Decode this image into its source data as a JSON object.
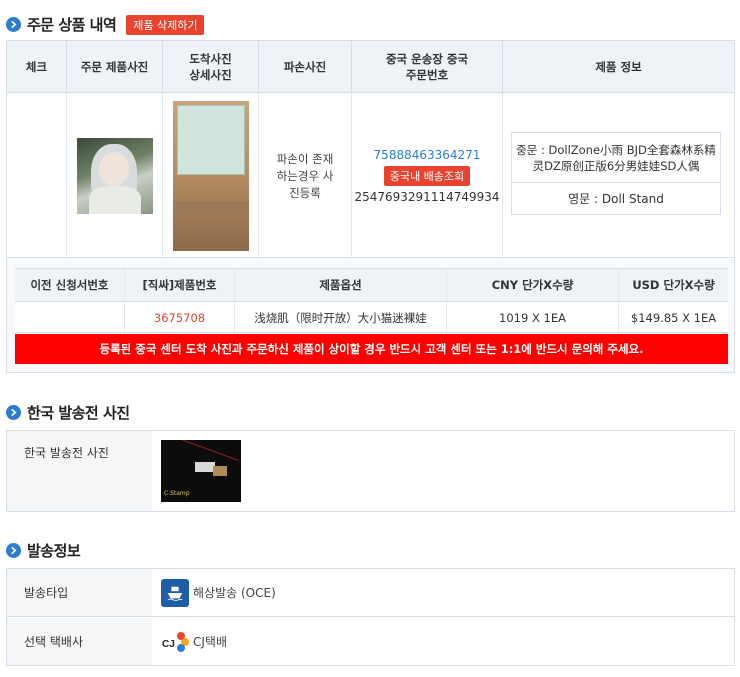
{
  "order": {
    "title": "주문 상품 내역",
    "delete_btn": "제품 삭제하기",
    "headers": {
      "check": "체크",
      "photo": "주문 제품사진",
      "arrival": "도착사진 상세사진",
      "damage": "파손사진",
      "tracking": "중국 운송장 중국 주문번호",
      "info": "제품 정보"
    },
    "damage_text": "파손이 존재하는경우 사진등록",
    "tracking_no": "75888463364271",
    "tracking_btn": "중국내 배송조회",
    "cn_order_no": "2547693291114749934",
    "info_cn": "중문 : DollZone小雨 BJD全套森林系精灵DZ原创正版6分男娃娃SD人偶",
    "info_en": "영문 : Doll Stand",
    "sub_headers": {
      "prev": "이전 신청서번호",
      "prodno": "[직싸]제품번호",
      "option": "제품옵션",
      "cny": "CNY 단가X수량",
      "usd": "USD 단가X수량"
    },
    "sub_row": {
      "prev": "",
      "prodno": "3675708",
      "option": "浅烧肌（限时开放）大小猫迷裸娃",
      "cny": "1019 X 1EA",
      "usd": "$149.85 X 1EA"
    },
    "warning": "등록된 중국 센터 도착 사진과 주문하신 제품이 상이할 경우 반드시 고객 센터 또는 1:1에 반드시 문의해 주세요."
  },
  "korea_photo": {
    "title": "한국 발송전 사진",
    "label": "한국 발송전 사진",
    "thumb_caption": "C.Stamp"
  },
  "shipping": {
    "title": "발송정보",
    "type_label": "발송타입",
    "type_value": "해상발송 (OCE)",
    "courier_label": "선택 택배사",
    "courier_value": "CJ택배"
  },
  "colors": {
    "accent": "#2b7cd3",
    "danger": "#e8432e",
    "warning_bar": "#ff0000"
  },
  "icons": [
    "chevron-right-icon",
    "ship-icon",
    "cj-logo-icon"
  ]
}
